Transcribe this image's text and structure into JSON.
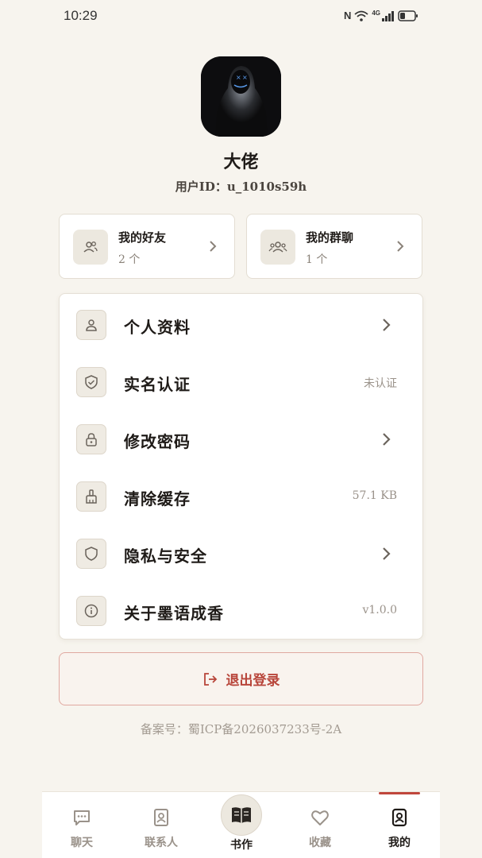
{
  "status_bar": {
    "time": "10:29",
    "network": "4G",
    "icons": [
      "nfc-icon",
      "wifi-icon",
      "signal-icon",
      "battery-icon"
    ]
  },
  "profile": {
    "username": "大佬",
    "user_id": "用户ID：u_1010s59h"
  },
  "summary": [
    {
      "title": "我的好友",
      "count": "2 个",
      "icon": "friends-icon"
    },
    {
      "title": "我的群聊",
      "count": "1 个",
      "icon": "group-chat-icon"
    }
  ],
  "menu": [
    {
      "label": "个人资料",
      "value": "",
      "icon": "person-icon",
      "chevron": true
    },
    {
      "label": "实名认证",
      "value": "未认证",
      "icon": "shield-check-icon",
      "chevron": false
    },
    {
      "label": "修改密码",
      "value": "",
      "icon": "lock-icon",
      "chevron": true
    },
    {
      "label": "清除缓存",
      "value": "57.1 KB",
      "icon": "broom-icon",
      "chevron": false
    },
    {
      "label": "隐私与安全",
      "value": "",
      "icon": "shield-icon",
      "chevron": true
    },
    {
      "label": "关于墨语成香",
      "value": "v1.0.0",
      "icon": "info-icon",
      "chevron": false
    }
  ],
  "logout_label": "退出登录",
  "icp": "备案号：蜀ICP备2026037233号-2A",
  "tabs": [
    {
      "label": "聊天",
      "icon": "chat-icon",
      "active": false
    },
    {
      "label": "联系人",
      "icon": "contacts-icon",
      "active": false
    },
    {
      "label": "书作",
      "icon": "book-icon",
      "active": false
    },
    {
      "label": "收藏",
      "icon": "heart-icon",
      "active": false
    },
    {
      "label": "我的",
      "icon": "profile-icon",
      "active": true
    }
  ],
  "colors": {
    "background": "#f7f4ee",
    "accent": "#c0463c",
    "logout_text": "#b8453a"
  }
}
